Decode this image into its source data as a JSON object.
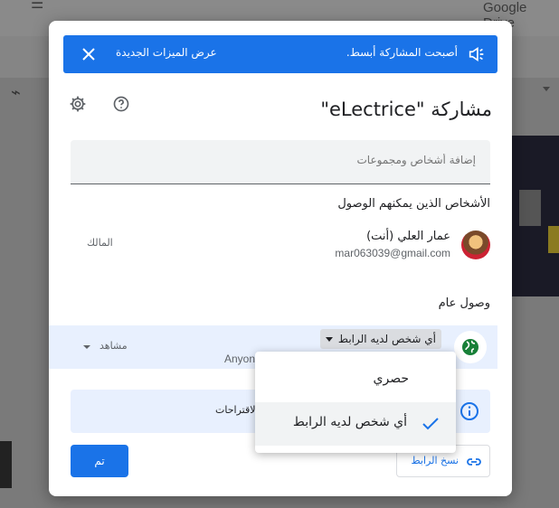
{
  "background": {
    "app_name": "Google Drive"
  },
  "banner": {
    "message": "أصبحت المشاركة أبسط.",
    "link_label": "عرض الميزات الجديدة",
    "color": "#1a73e8"
  },
  "dialog": {
    "title": "مشاركة \"eLectrice\"",
    "add_people_placeholder": "إضافة أشخاص ومجموعات",
    "people_header": "الأشخاص الذين يمكنهم الوصول",
    "person": {
      "name": "عمار العلي (أنت)",
      "email": "mar063039@gmail.com",
      "role": "المالك"
    },
    "general_access_header": "وصول عام",
    "general_access": {
      "link_setting": "أي شخص لديه الرابط",
      "description": "Anyon",
      "role": "مشاهد"
    },
    "info_text": "الاقتراحات",
    "copy_link_label": "نسخ الرابط",
    "done_label": "تم"
  },
  "dropdown_menu": {
    "options": [
      {
        "label": "حصري",
        "selected": false
      },
      {
        "label": "أي شخص لديه الرابط",
        "selected": true
      }
    ]
  },
  "icons": {
    "megaphone": "megaphone-icon",
    "close": "close-icon",
    "settings": "gear-icon",
    "help": "help-icon",
    "globe": "globe-icon",
    "info": "info-icon",
    "link": "link-icon",
    "check": "check-icon"
  }
}
